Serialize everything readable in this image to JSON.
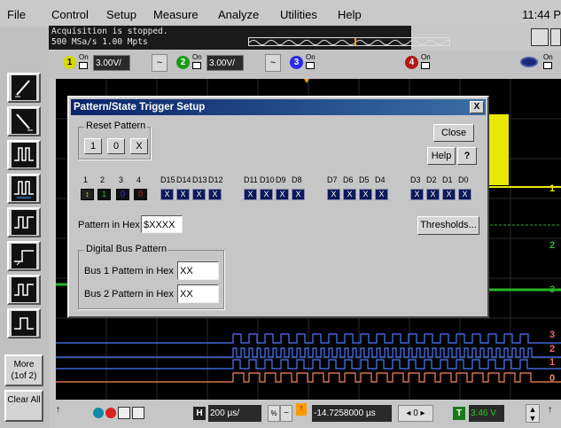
{
  "menu": {
    "file": "File",
    "control": "Control",
    "setup": "Setup",
    "measure": "Measure",
    "analyze": "Analyze",
    "utilities": "Utilities",
    "help": "Help",
    "clock": "11:44 P"
  },
  "status": {
    "line1": "Acquisition is stopped.",
    "line2": "500 MSa/s    1.00 Mpts"
  },
  "channels": [
    {
      "num": "1",
      "on_label": "On",
      "volts": "3.00V/",
      "color": "#e8e800"
    },
    {
      "num": "2",
      "on_label": "On",
      "volts": "3.00V/",
      "color": "#2ab52a"
    },
    {
      "num": "3",
      "on_label": "On",
      "color": "#3a3aff"
    },
    {
      "num": "4",
      "on_label": "On",
      "color": "#cc2222"
    }
  ],
  "left_buttons": {
    "more": "More (1of 2)",
    "clear": "Clear All"
  },
  "dialog": {
    "title": "Pattern/State Trigger Setup",
    "close_x": "X",
    "reset_group": "Reset Pattern",
    "reset_buttons": [
      "1",
      "0",
      "X"
    ],
    "close_button": "Close",
    "help_button": "Help",
    "help_icon": "?",
    "bits": [
      {
        "label": "1",
        "value": "↕",
        "color": "#e8e800"
      },
      {
        "label": "2",
        "value": "1",
        "color": "#2ab52a"
      },
      {
        "label": "3",
        "value": "0",
        "color": "#3a3aff"
      },
      {
        "label": "4",
        "value": "0",
        "color": "#cc2222"
      }
    ],
    "digital_labels": [
      "D15",
      "D14",
      "D13",
      "D12",
      "D11",
      "D10",
      "D9",
      "D8",
      "D7",
      "D6",
      "D5",
      "D4",
      "D3",
      "D2",
      "D1",
      "D0"
    ],
    "digital_value": "X",
    "hex_label": "Pattern in Hex",
    "hex_value": "$XXXX",
    "thresholds_button": "Thresholds...",
    "bus_group": "Digital Bus Pattern",
    "bus1_label": "Bus 1 Pattern in Hex",
    "bus1_value": "XX",
    "bus2_label": "Bus 2 Pattern in Hex",
    "bus2_value": "XX"
  },
  "trace_labels": [
    "1",
    "2",
    "3",
    "3",
    "2",
    "1",
    "0"
  ],
  "bottom": {
    "timebase_icon": "H",
    "timebase": "200 µs/",
    "delay": "-14.7258000 µs",
    "trigger_icon": "T",
    "trigger_level": "3.46 V"
  }
}
